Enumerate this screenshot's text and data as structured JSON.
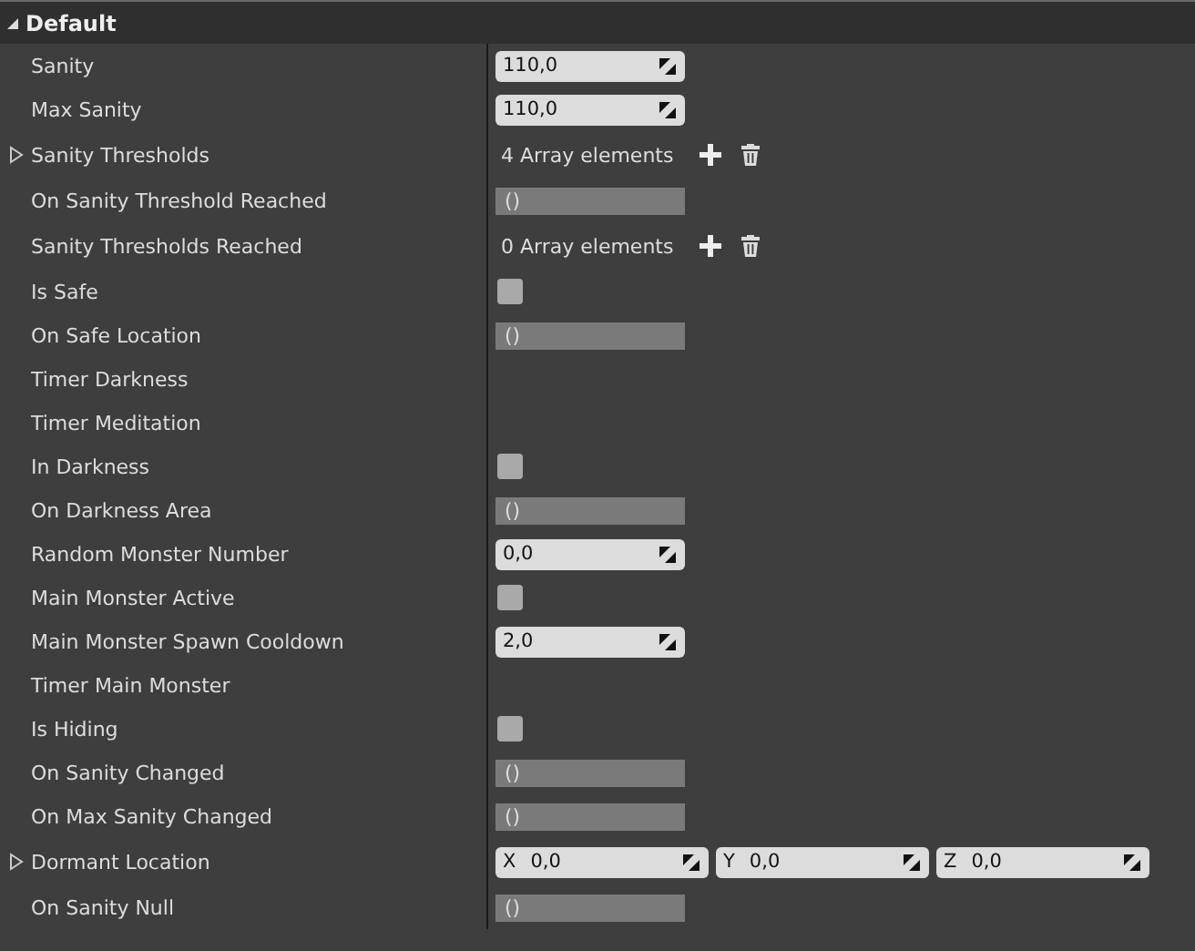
{
  "section": {
    "title": "Default",
    "expanded": true
  },
  "rows": [
    {
      "label": "Sanity",
      "kind": "number",
      "value": "110,0"
    },
    {
      "label": "Max Sanity",
      "kind": "number",
      "value": "110,0"
    },
    {
      "label": "Sanity Thresholds",
      "kind": "array",
      "value": "4 Array elements",
      "expanded": false
    },
    {
      "label": "On Sanity Threshold Reached",
      "kind": "delegate",
      "value": "()"
    },
    {
      "label": "Sanity Thresholds Reached",
      "kind": "array",
      "value": "0 Array elements"
    },
    {
      "label": "Is Safe",
      "kind": "checkbox",
      "checked": false
    },
    {
      "label": "On Safe Location",
      "kind": "delegate",
      "value": "()"
    },
    {
      "label": "Timer Darkness",
      "kind": "none"
    },
    {
      "label": "Timer Meditation",
      "kind": "none"
    },
    {
      "label": "In Darkness",
      "kind": "checkbox",
      "checked": false
    },
    {
      "label": "On Darkness Area",
      "kind": "delegate",
      "value": "()"
    },
    {
      "label": "Random Monster Number",
      "kind": "number",
      "value": "0,0"
    },
    {
      "label": "Main Monster Active",
      "kind": "checkbox",
      "checked": false
    },
    {
      "label": "Main Monster Spawn Cooldown",
      "kind": "number",
      "value": "2,0"
    },
    {
      "label": "Timer Main Monster",
      "kind": "none"
    },
    {
      "label": "Is Hiding",
      "kind": "checkbox",
      "checked": false
    },
    {
      "label": "On Sanity Changed",
      "kind": "delegate",
      "value": "()"
    },
    {
      "label": "On Max Sanity Changed",
      "kind": "delegate",
      "value": "()"
    },
    {
      "label": "Dormant Location",
      "kind": "vector",
      "expanded": false,
      "components": [
        {
          "axis": "X",
          "value": "0,0"
        },
        {
          "axis": "Y",
          "value": "0,0"
        },
        {
          "axis": "Z",
          "value": "0,0"
        }
      ]
    },
    {
      "label": "On Sanity Null",
      "kind": "delegate",
      "value": "()"
    }
  ]
}
